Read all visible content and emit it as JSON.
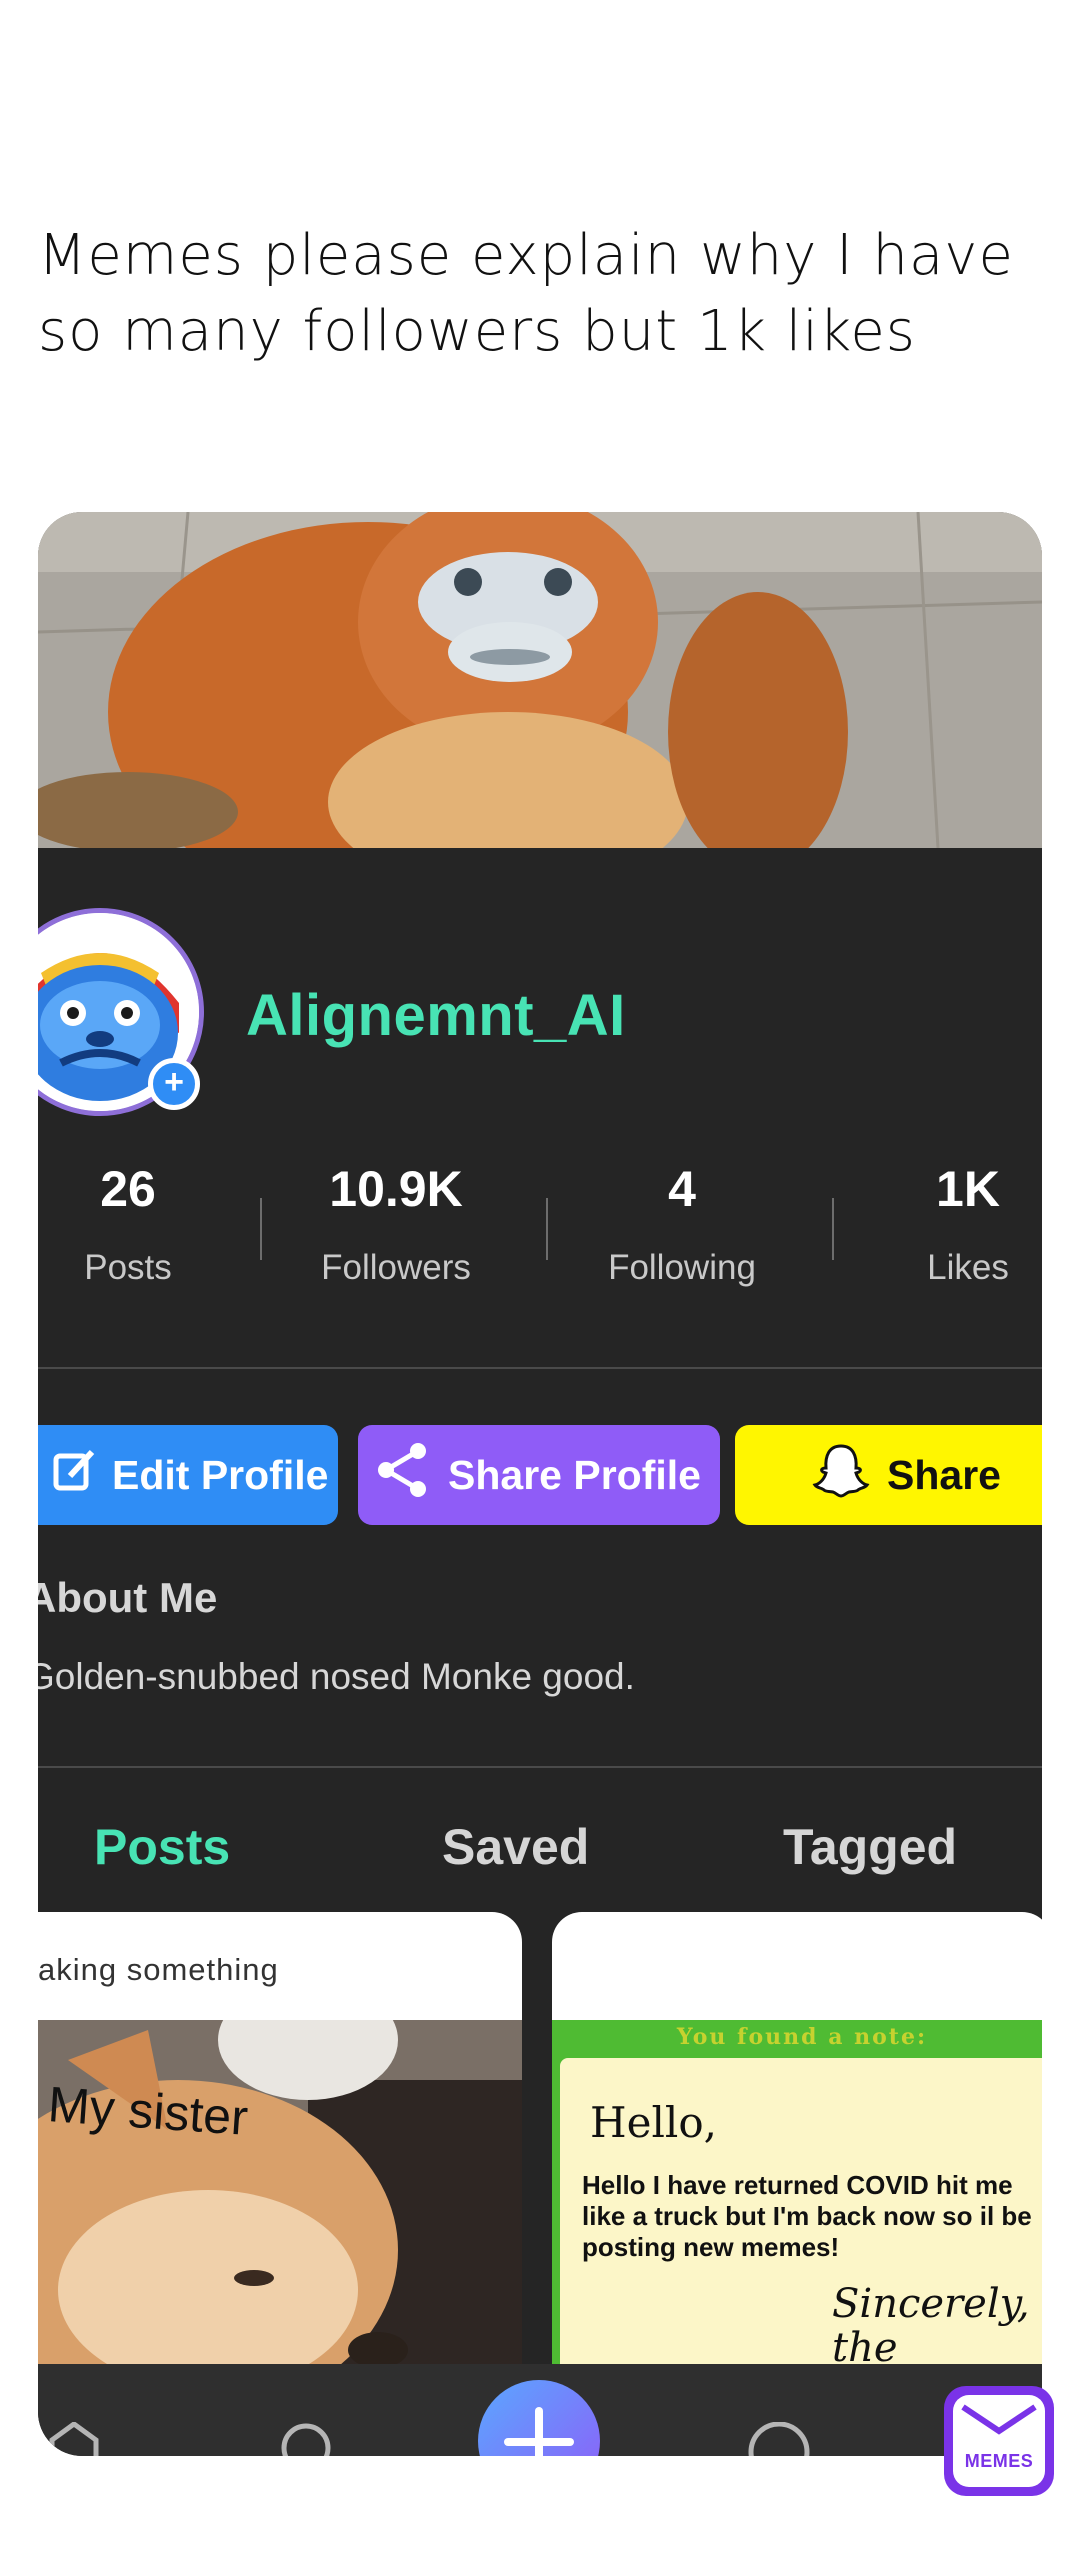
{
  "caption": "Memes please explain why I have so many followers but 1k likes",
  "profile": {
    "username": "Alignemnt_AI",
    "stats": [
      {
        "value": "26",
        "label": "Posts"
      },
      {
        "value": "10.9K",
        "label": "Followers"
      },
      {
        "value": "4",
        "label": "Following"
      },
      {
        "value": "1K",
        "label": "Likes"
      }
    ],
    "buttons": {
      "edit": "Edit Profile",
      "share": "Share Profile",
      "snap": "Share"
    },
    "about": {
      "title": "About Me",
      "text": "Golden-snubbed nosed Monke good."
    },
    "tabs": [
      {
        "label": "Posts",
        "active": true
      },
      {
        "label": "Saved",
        "active": false
      },
      {
        "label": "Tagged",
        "active": false
      }
    ],
    "posts": [
      {
        "caption": "aking something",
        "image_text": "My sister"
      },
      {
        "header": "You found a note:",
        "greeting": "Hello,",
        "body": "Hello I have returned COVID hit me like a truck but I'm back now so il be posting new memes!",
        "signature": "Sincerely, the Zombies"
      }
    ]
  },
  "colors": {
    "accent": "#48e3b4",
    "card_bg": "#252525",
    "edit_button": "#2f8df5",
    "share_button": "#8f5cf7",
    "snap_button": "#fff600"
  },
  "watermark": {
    "text": "MEMES"
  }
}
